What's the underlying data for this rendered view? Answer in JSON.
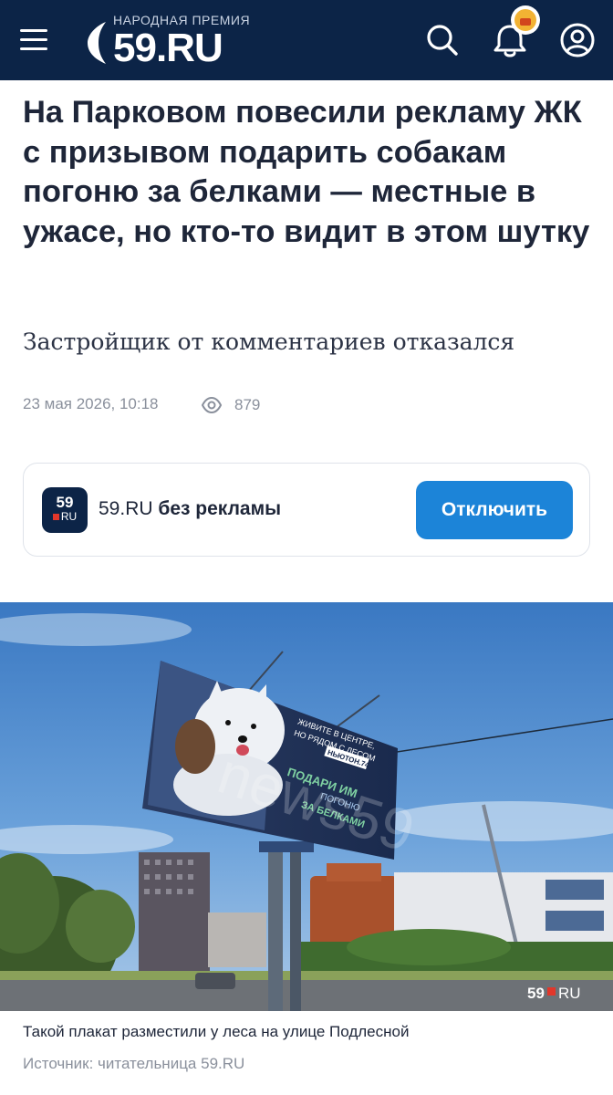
{
  "header": {
    "logo_award": "НАРОДНАЯ ПРЕМИЯ",
    "logo_text": "59.RU",
    "brand_color": "#0c2447",
    "icons": [
      "menu-icon",
      "search-icon",
      "bell-icon",
      "user-icon"
    ]
  },
  "article": {
    "title": "На Парковом повесили рекламу ЖК с призывом подарить собакам погоню за белками — местные в ужасе, но кто-то видит в этом шутку",
    "subtitle": "Застройщик от комментариев отказался",
    "date": "23 мая 2026, 10:18",
    "views": "879"
  },
  "promo": {
    "logo_num": "59",
    "logo_ru": "RU",
    "site": "59.RU",
    "text": "без рекламы",
    "button": "Отключить",
    "button_color": "#1c84d8"
  },
  "photo": {
    "billboard": {
      "line1": "ЖИВИТЕ В ЦЕНТРЕ,",
      "line2": "НО РЯДОМ С ЛЕСОМ",
      "brand": "НЬЮТОН.74",
      "slogan1": "ПОДАРИ ИМ",
      "slogan2": "ПОГОНЮ",
      "slogan3": "ЗА БЕЛКАМИ"
    },
    "watermark": "news59",
    "corner_logo": "59",
    "corner_logo_ru": "RU",
    "caption": "Такой плакат разместили у леса на улице Подлесной",
    "source": "Источник: читательница 59.RU"
  }
}
